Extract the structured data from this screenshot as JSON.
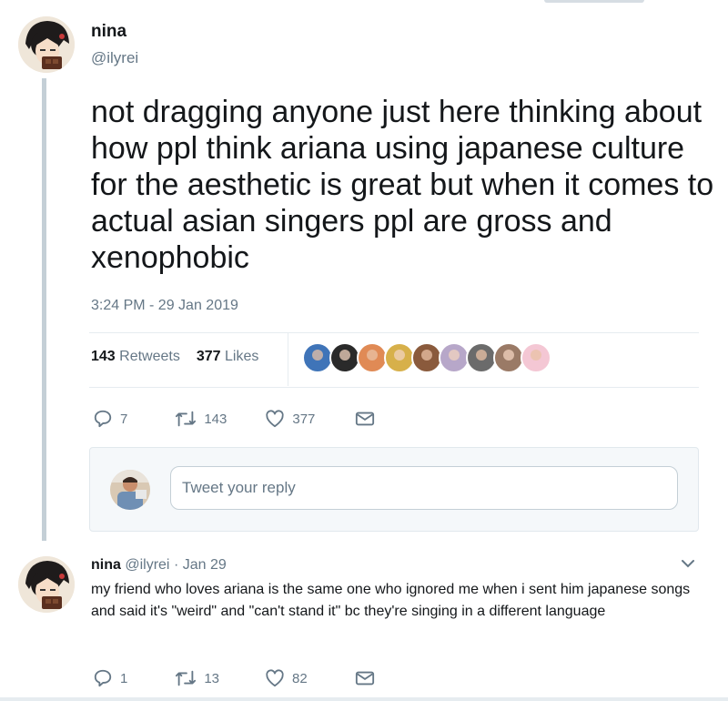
{
  "tweet": {
    "author": {
      "name": "nina",
      "handle": "@ilyrei"
    },
    "text": "not dragging anyone just here thinking about how ppl think ariana using japanese culture for the aesthetic is great but when it comes to actual asian singers ppl are gross and xenophobic",
    "timestamp": "3:24 PM - 29 Jan 2019",
    "stats": {
      "retweets_count": "143",
      "retweets_label": "Retweets",
      "likes_count": "377",
      "likes_label": "Likes"
    },
    "likers_faces": [
      "#3f74b8",
      "#2a2a2a",
      "#e08a55",
      "#d7b04a",
      "#8a5a3c",
      "#b7a7c9",
      "#6b6b6b",
      "#9a7a66",
      "#f4c7d4"
    ],
    "actions": {
      "reply_count": "7",
      "retweet_count": "143",
      "like_count": "377"
    }
  },
  "reply_composer": {
    "placeholder": "Tweet your reply"
  },
  "reply": {
    "name": "nina",
    "handle": "@ilyrei",
    "separator": "·",
    "date": "Jan 29",
    "text": "my friend who loves ariana is the same one who ignored me when i sent him japanese songs and said it's \"weird\" and \"can't stand it\" bc they're singing in a different language",
    "actions": {
      "reply_count": "1",
      "retweet_count": "13",
      "like_count": "82"
    }
  },
  "colors": {
    "text": "#14171a",
    "muted": "#657786",
    "thread_line": "#c4cfd6",
    "border": "#e6ecf0"
  }
}
